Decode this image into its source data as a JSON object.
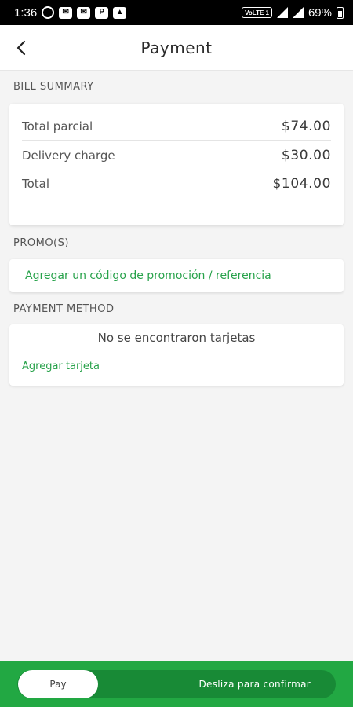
{
  "status_bar": {
    "time": "1:36",
    "network_label": "VoLTE 1",
    "battery": "69%"
  },
  "header": {
    "title": "Payment",
    "back_icon": "chevron-left-icon"
  },
  "bill_summary": {
    "label": "BILL SUMMARY",
    "rows": [
      {
        "label": "Total parcial",
        "amount": "$74.00"
      },
      {
        "label": "Delivery charge",
        "amount": "$30.00"
      },
      {
        "label": "Total",
        "amount": "$104.00"
      }
    ]
  },
  "promos": {
    "label": "PROMO(S)",
    "link": "Agregar un código de promoción / referencia"
  },
  "payment_method": {
    "label": "PAYMENT METHOD",
    "empty_message": "No se encontraron tarjetas",
    "add_link": "Agregar tarjeta"
  },
  "bottom": {
    "knob_label": "Pay",
    "hint": "Desliza para confirmar"
  },
  "colors": {
    "accent_green": "#22a843",
    "link_green": "#27a24a"
  }
}
